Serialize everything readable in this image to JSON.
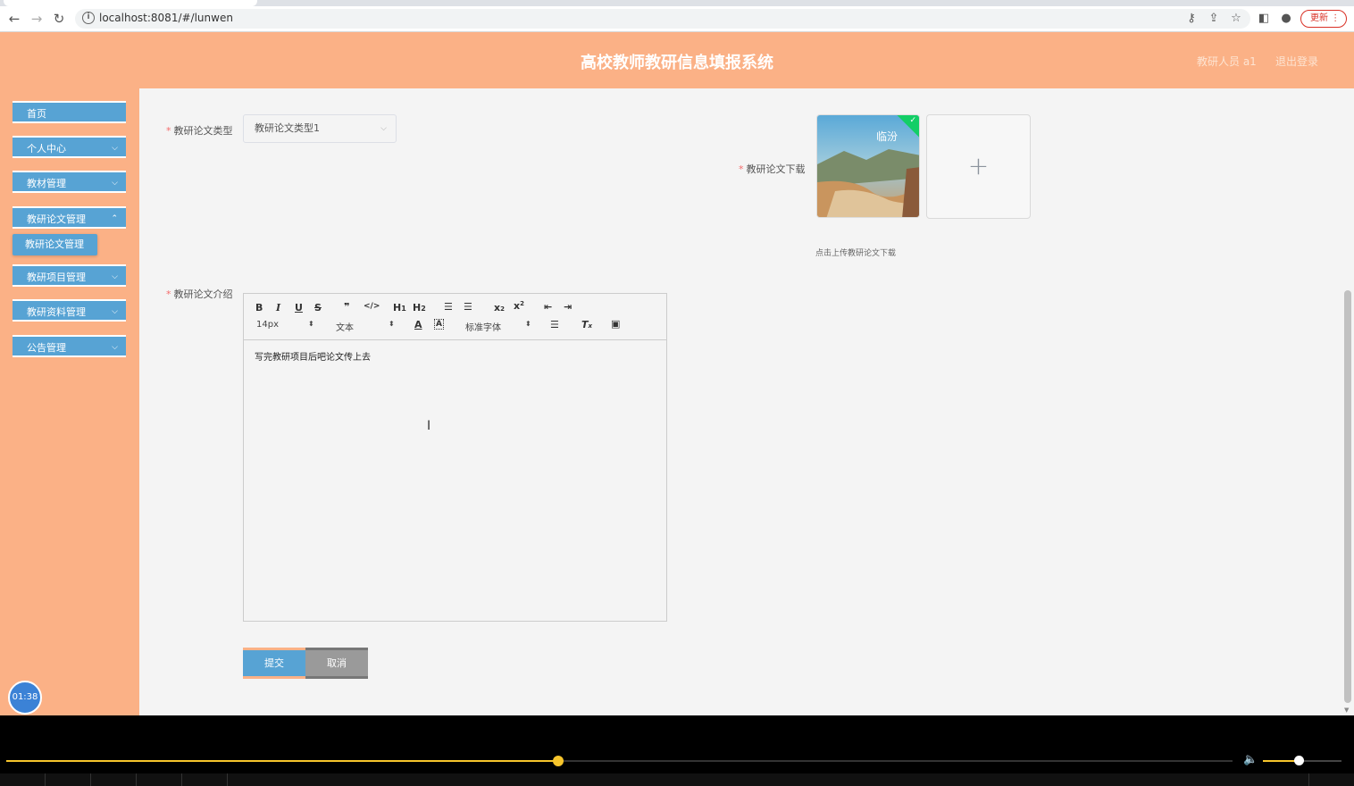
{
  "browser": {
    "url": "localhost:8081/#/lunwen",
    "update_label": "更新"
  },
  "header": {
    "title": "高校教师教研信息填报系统",
    "user": "教研人员 a1",
    "logout": "退出登录"
  },
  "sidebar": {
    "items": [
      {
        "label": "首页"
      },
      {
        "label": "个人中心"
      },
      {
        "label": "教材管理"
      },
      {
        "label": "教研论文管理"
      },
      {
        "label": "教研项目管理"
      },
      {
        "label": "教研资料管理"
      },
      {
        "label": "公告管理"
      }
    ],
    "active_sub": "教研论文管理",
    "timer": "01:38"
  },
  "form": {
    "type_label": "教研论文类型",
    "type_value": "教研论文类型1",
    "download_label": "教研论文下载",
    "upload_hint": "点击上传教研论文下载",
    "intro_label": "教研论文介绍",
    "intro_content": "写完教研项目后吧论文传上去",
    "submit": "提交",
    "cancel": "取消"
  },
  "editor": {
    "font_size": "14px",
    "block_format": "文本",
    "font_family": "标准字体"
  },
  "player": {
    "progress": 0.45,
    "volume": 0.45
  },
  "colors": {
    "header_bg": "#fbb186",
    "menu_bg": "#57a3d4",
    "accent_yellow": "#f7c52c"
  }
}
